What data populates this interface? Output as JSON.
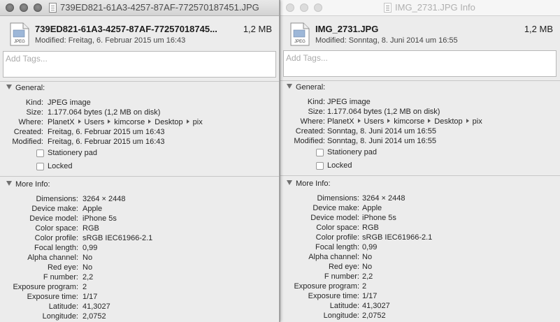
{
  "windows": [
    {
      "title": "739ED821-61A3-4257-87AF-772570187451.JPG",
      "filename": "739ED821-61A3-4257-87AF-77257018745...",
      "size": "1,2 MB",
      "modified": "Modified: Freitag, 6. Februar 2015 um 16:43",
      "icon_label": "JPEG",
      "tags_placeholder": "Add Tags...",
      "general": {
        "header": "General:",
        "rows": [
          {
            "label": "Kind:",
            "value": "JPEG image"
          },
          {
            "label": "Size:",
            "value": "1.177.064 bytes (1,2 MB on disk)"
          },
          {
            "label": "Where:",
            "path": [
              "PlanetX",
              "Users",
              "kimcorse",
              "Desktop",
              "pix"
            ]
          },
          {
            "label": "Created:",
            "value": "Freitag, 6. Februar 2015 um 16:43"
          },
          {
            "label": "Modified:",
            "value": "Freitag, 6. Februar 2015 um 16:43"
          }
        ],
        "stationery": "Stationery pad",
        "locked": "Locked"
      },
      "more": {
        "header": "More Info:",
        "rows": [
          {
            "label": "Dimensions:",
            "value": "3264 × 2448"
          },
          {
            "label": "Device make:",
            "value": "Apple"
          },
          {
            "label": "Device model:",
            "value": "iPhone 5s"
          },
          {
            "label": "Color space:",
            "value": "RGB"
          },
          {
            "label": "Color profile:",
            "value": "sRGB IEC61966-2.1"
          },
          {
            "label": "Focal length:",
            "value": "0,99"
          },
          {
            "label": "Alpha channel:",
            "value": "No"
          },
          {
            "label": "Red eye:",
            "value": "No"
          },
          {
            "label": "F number:",
            "value": "2,2"
          },
          {
            "label": "Exposure program:",
            "value": "2"
          },
          {
            "label": "Exposure time:",
            "value": "1/17"
          },
          {
            "label": "Latitude:",
            "value": "41,3027"
          },
          {
            "label": "Longitude:",
            "value": "2,0752"
          }
        ]
      }
    },
    {
      "title": "IMG_2731.JPG Info",
      "filename": "IMG_2731.JPG",
      "size": "1,2 MB",
      "modified": "Modified: Sonntag, 8. Juni 2014 um 16:55",
      "icon_label": "JPEG",
      "tags_placeholder": "Add Tags...",
      "general": {
        "header": "General:",
        "rows": [
          {
            "label": "Kind:",
            "value": "JPEG image"
          },
          {
            "label": "Size:",
            "value": "1.177.064 bytes (1,2 MB on disk)"
          },
          {
            "label": "Where:",
            "path": [
              "PlanetX",
              "Users",
              "kimcorse",
              "Desktop",
              "pix"
            ]
          },
          {
            "label": "Created:",
            "value": "Sonntag, 8. Juni 2014 um 16:55"
          },
          {
            "label": "Modified:",
            "value": "Sonntag, 8. Juni 2014 um 16:55"
          }
        ],
        "stationery": "Stationery pad",
        "locked": "Locked"
      },
      "more": {
        "header": "More Info:",
        "rows": [
          {
            "label": "Dimensions:",
            "value": "3264 × 2448"
          },
          {
            "label": "Device make:",
            "value": "Apple"
          },
          {
            "label": "Device model:",
            "value": "iPhone 5s"
          },
          {
            "label": "Color space:",
            "value": "RGB"
          },
          {
            "label": "Color profile:",
            "value": "sRGB IEC61966-2.1"
          },
          {
            "label": "Focal length:",
            "value": "0,99"
          },
          {
            "label": "Alpha channel:",
            "value": "No"
          },
          {
            "label": "Red eye:",
            "value": "No"
          },
          {
            "label": "F number:",
            "value": "2,2"
          },
          {
            "label": "Exposure program:",
            "value": "2"
          },
          {
            "label": "Exposure time:",
            "value": "1/17"
          },
          {
            "label": "Latitude:",
            "value": "41,3027"
          },
          {
            "label": "Longitude:",
            "value": "2,0752"
          }
        ]
      }
    }
  ]
}
